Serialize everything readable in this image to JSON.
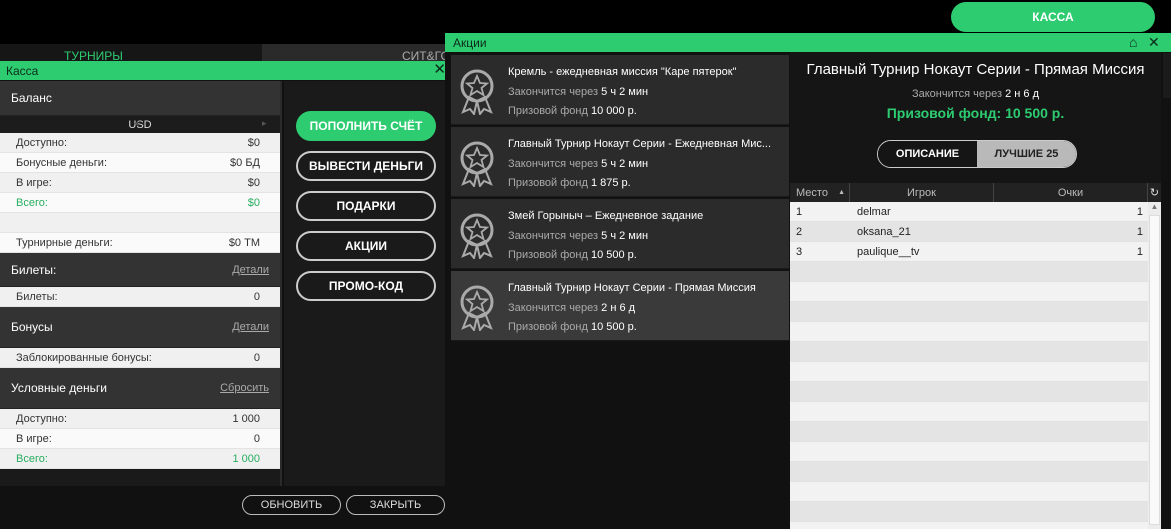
{
  "top": {
    "kassa_button": "КАССА"
  },
  "lobby": {
    "tab_tournaments": "ТУРНИРЫ",
    "tab_sitgo": "СИТ&ГО"
  },
  "kassa": {
    "title": "Касса",
    "balance": {
      "header": "Баланс",
      "currency": "USD",
      "rows": [
        {
          "label": "Доступно:",
          "value": "$0",
          "style": ""
        },
        {
          "label": "Бонусные деньги:",
          "value": "$0 БД",
          "style": "alt"
        },
        {
          "label": "В игре:",
          "value": "$0",
          "style": ""
        },
        {
          "label": "Всего:",
          "value": "$0",
          "style": "alt green"
        },
        {
          "label": "",
          "value": "",
          "style": "blank"
        },
        {
          "label": "Турнирные деньги:",
          "value": "$0 ТМ",
          "style": "alt"
        }
      ]
    },
    "tickets": {
      "header": "Билеты:",
      "link": "Детали",
      "rows": [
        {
          "label": "Билеты:",
          "value": "0",
          "style": ""
        }
      ]
    },
    "bonuses": {
      "header": "Бонусы",
      "link": "Детали",
      "rows": [
        {
          "label": "Заблокированные бонусы:",
          "value": "0",
          "style": ""
        }
      ]
    },
    "play_money": {
      "header": "Условные деньги",
      "link": "Сбросить",
      "rows": [
        {
          "label": "Доступно:",
          "value": "1 000",
          "style": ""
        },
        {
          "label": "В игре:",
          "value": "0",
          "style": "alt"
        },
        {
          "label": "Всего:",
          "value": "1 000",
          "style": "green"
        }
      ]
    },
    "buttons": {
      "deposit": "ПОПОЛНИТЬ СЧЁТ",
      "withdraw": "ВЫВЕСТИ ДЕНЬГИ",
      "gifts": "ПОДАРКИ",
      "promos": "АКЦИИ",
      "promo_code": "ПРОМО-КОД"
    },
    "footer": {
      "refresh": "ОБНОВИТЬ",
      "close": "ЗАКРЫТЬ"
    }
  },
  "promos": {
    "title": "Акции",
    "ends_label": "Закончится через",
    "prize_label": "Призовой фонд",
    "items": [
      {
        "title": "Кремль - ежедневная миссия \"Каре пятерок\"",
        "ends": "5 ч 2 мин",
        "prize": "10 000 р.",
        "selected": false
      },
      {
        "title": "Главный Турнир Нокаут Серии - Ежедневная Мис...",
        "ends": "5 ч 2 мин",
        "prize": "1 875 р.",
        "selected": false
      },
      {
        "title": "Змей Горыныч – Ежедневное задание",
        "ends": "5 ч 2 мин",
        "prize": "10 500 р.",
        "selected": false
      },
      {
        "title": "Главный Турнир Нокаут Серии - Прямая Миссия",
        "ends": "2 н 6 д",
        "prize": "10 500 р.",
        "selected": true
      }
    ],
    "detail": {
      "title": "Главный Турнир Нокаут Серии - Прямая Миссия",
      "ends_label": "Закончится через",
      "ends": "2 н 6 д",
      "prize": "Призовой фонд: 10 500 р.",
      "tab_description": "ОПИСАНИЕ",
      "tab_top": "ЛУЧШИЕ 25",
      "columns": {
        "place": "Место",
        "player": "Игрок",
        "points": "Очки"
      },
      "rows": [
        {
          "place": "1",
          "player": "delmar",
          "points": "1"
        },
        {
          "place": "2",
          "player": "oksana_21",
          "points": "1"
        },
        {
          "place": "3",
          "player": "paulique__tv",
          "points": "1"
        }
      ]
    }
  }
}
